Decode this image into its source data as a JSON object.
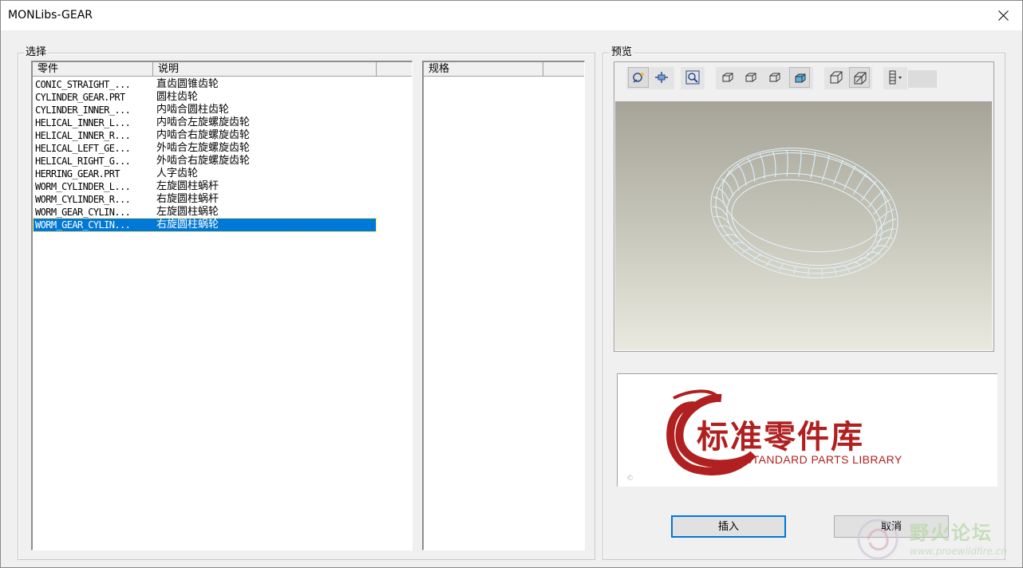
{
  "window": {
    "title": "MONLibs-GEAR"
  },
  "select_group": {
    "label": "选择",
    "columns": [
      "零件",
      "说明",
      ""
    ],
    "rows": [
      {
        "part": "CONIC_STRAIGHT_...",
        "desc": "直齿圆锥齿轮"
      },
      {
        "part": "CYLINDER_GEAR.PRT",
        "desc": "圆柱齿轮"
      },
      {
        "part": "CYLINDER_INNER_...",
        "desc": "内啮合圆柱齿轮"
      },
      {
        "part": "HELICAL_INNER_L...",
        "desc": "内啮合左旋螺旋齿轮"
      },
      {
        "part": "HELICAL_INNER_R...",
        "desc": "内啮合右旋螺旋齿轮"
      },
      {
        "part": "HELICAL_LEFT_GE...",
        "desc": "外啮合左旋螺旋齿轮"
      },
      {
        "part": "HELICAL_RIGHT_G...",
        "desc": "外啮合右旋螺旋齿轮"
      },
      {
        "part": "HERRING_GEAR.PRT",
        "desc": "人字齿轮"
      },
      {
        "part": "WORM_CYLINDER_L...",
        "desc": "左旋圆柱蜗杆"
      },
      {
        "part": "WORM_CYLINDER_R...",
        "desc": "右旋圆柱蜗杆"
      },
      {
        "part": "WORM_GEAR_CYLIN...",
        "desc": "左旋圆柱蜗轮"
      },
      {
        "part": "WORM_GEAR_CYLIN...",
        "desc": "右旋圆柱蜗轮"
      }
    ],
    "selected_row": 11,
    "spec_columns": [
      "规格",
      ""
    ]
  },
  "preview_group": {
    "label": "预览",
    "toolbar_icons": [
      "spin-icon",
      "pan-icon",
      "zoom-window-icon",
      "view-wireframe-icon",
      "view-hidden-icon",
      "view-no-hidden-icon",
      "view-shaded-icon",
      "orient-3d-icon",
      "orient-saved-icon",
      "film-menu-icon"
    ]
  },
  "logo": {
    "cn": "标准零件库",
    "en": "STANDARD PARTS LIBRARY",
    "mark": "©"
  },
  "buttons": {
    "insert": "插入",
    "cancel": "取消"
  },
  "watermark": {
    "text": "野火论坛",
    "url": "www.proewildfire.cn"
  },
  "colors": {
    "selection": "#0078d7",
    "logo_red": "#b02020",
    "wireframe": "#d8ecf8"
  }
}
